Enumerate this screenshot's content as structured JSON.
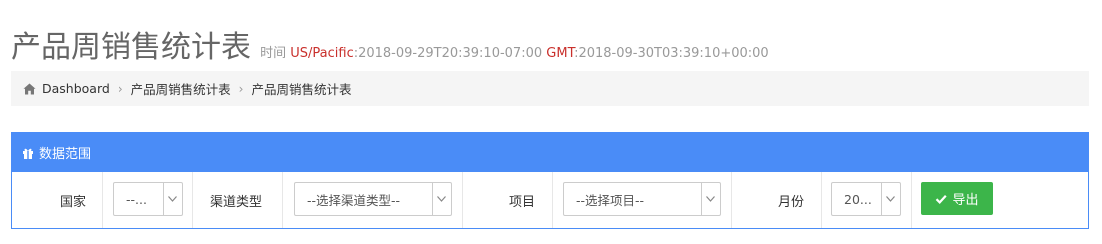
{
  "header": {
    "title": "产品周销售统计表",
    "time_label": "时间",
    "tz_local_name": "US/Pacific",
    "tz_local_time": ":2018-09-29T20:39:10-07:00",
    "tz_gmt_name": "GMT",
    "tz_gmt_time": ":2018-09-30T03:39:10+00:00"
  },
  "breadcrumb": {
    "items": [
      "Dashboard",
      "产品周销售统计表",
      "产品周销售统计表"
    ],
    "separator": "›"
  },
  "panel": {
    "title": "数据范围",
    "heading_color": "#4a8cf7"
  },
  "filters": {
    "country": {
      "label": "国家",
      "value": "--..."
    },
    "channel_type": {
      "label": "渠道类型",
      "value": "--选择渠道类型--"
    },
    "project": {
      "label": "项目",
      "value": "--选择项目--"
    },
    "month": {
      "label": "月份",
      "value": "20..."
    }
  },
  "actions": {
    "export_label": "导出",
    "export_color": "#3cb54a"
  },
  "icons": {
    "breadcrumb_home": "home-icon",
    "panel": "gift-icon",
    "export": "check-icon",
    "select": "chevron-down-icon"
  }
}
